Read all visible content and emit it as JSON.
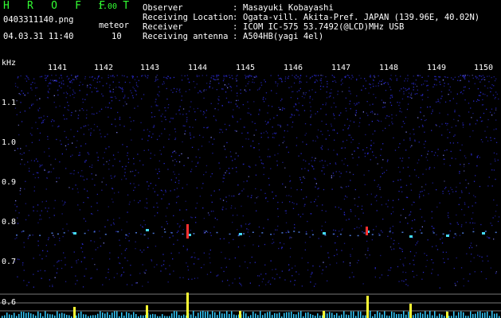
{
  "app": {
    "title": "H R O F F T",
    "version": "1.00",
    "filename": "0403311140.png",
    "datetime": "04.03.31 11:40",
    "meteor_label": "meteor",
    "meteor_count": "10"
  },
  "info": {
    "observer_label": "Observer",
    "observer_value": "Masayuki Kobayashi",
    "location_label": "Receiving Location",
    "location_value": "Ogata-vill. Akita-Pref. JAPAN (139.96E, 40.02N)",
    "receiver_label": "Receiver",
    "receiver_value": "ICOM IC-575 53.7492(@LCD)MHz USB",
    "antenna_label": "Receiving antenna",
    "antenna_value": "A504HB(yagi 4el)",
    "colon": ":"
  },
  "axis": {
    "freq_unit": "kHz",
    "freq_labels": [
      "1.1",
      "1.0",
      "0.9",
      "0.8",
      "0.7",
      "0.6"
    ],
    "time_labels": [
      "1141",
      "1142",
      "1143",
      "1144",
      "1145",
      "1146",
      "1147",
      "1148",
      "1149",
      "1150"
    ]
  },
  "colors": {
    "title_green": "#33ff33",
    "noise_blue": "#2a2ad0",
    "echo_red": "#ff3030",
    "echo_cyan": "#44ddff",
    "bar_yellow": "#ffff33",
    "bar_cyan": "#33ccff"
  }
}
